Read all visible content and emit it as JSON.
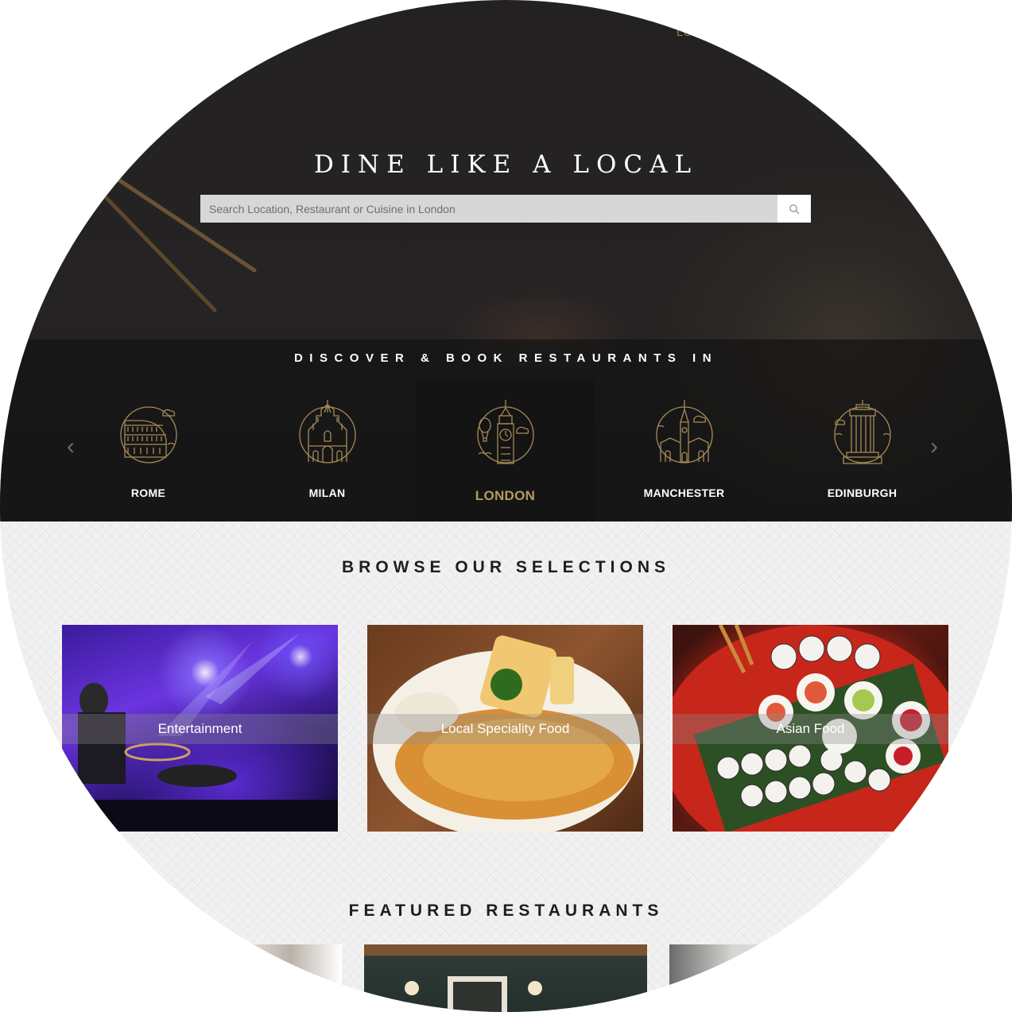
{
  "header": {
    "top_link": "LO"
  },
  "hero": {
    "title": "DINE LIKE A LOCAL",
    "search_placeholder": "Search Location, Restaurant or Cuisine in London",
    "search_icon": "search-icon"
  },
  "cities": {
    "heading": "DISCOVER & BOOK RESTAURANTS IN",
    "prev_arrow": "‹",
    "next_arrow": "›",
    "items": [
      {
        "label": "ROME",
        "icon": "colosseum-icon"
      },
      {
        "label": "MILAN",
        "icon": "milan-cathedral-icon"
      },
      {
        "label": "LONDON",
        "icon": "big-ben-icon",
        "active": true
      },
      {
        "label": "MANCHESTER",
        "icon": "manchester-town-hall-icon"
      },
      {
        "label": "EDINBURGH",
        "icon": "edinburgh-monument-icon"
      }
    ]
  },
  "selections": {
    "title": "BROWSE OUR SELECTIONS",
    "cards": [
      {
        "label": "Entertainment"
      },
      {
        "label": "Local Speciality Food"
      },
      {
        "label": "Asian Food"
      }
    ]
  },
  "featured": {
    "title": "FEATURED RESTAURANTS"
  },
  "colors": {
    "accent_gold": "#b39a62",
    "hero_bg": "#232122",
    "lower_bg": "#f1f1f1"
  }
}
